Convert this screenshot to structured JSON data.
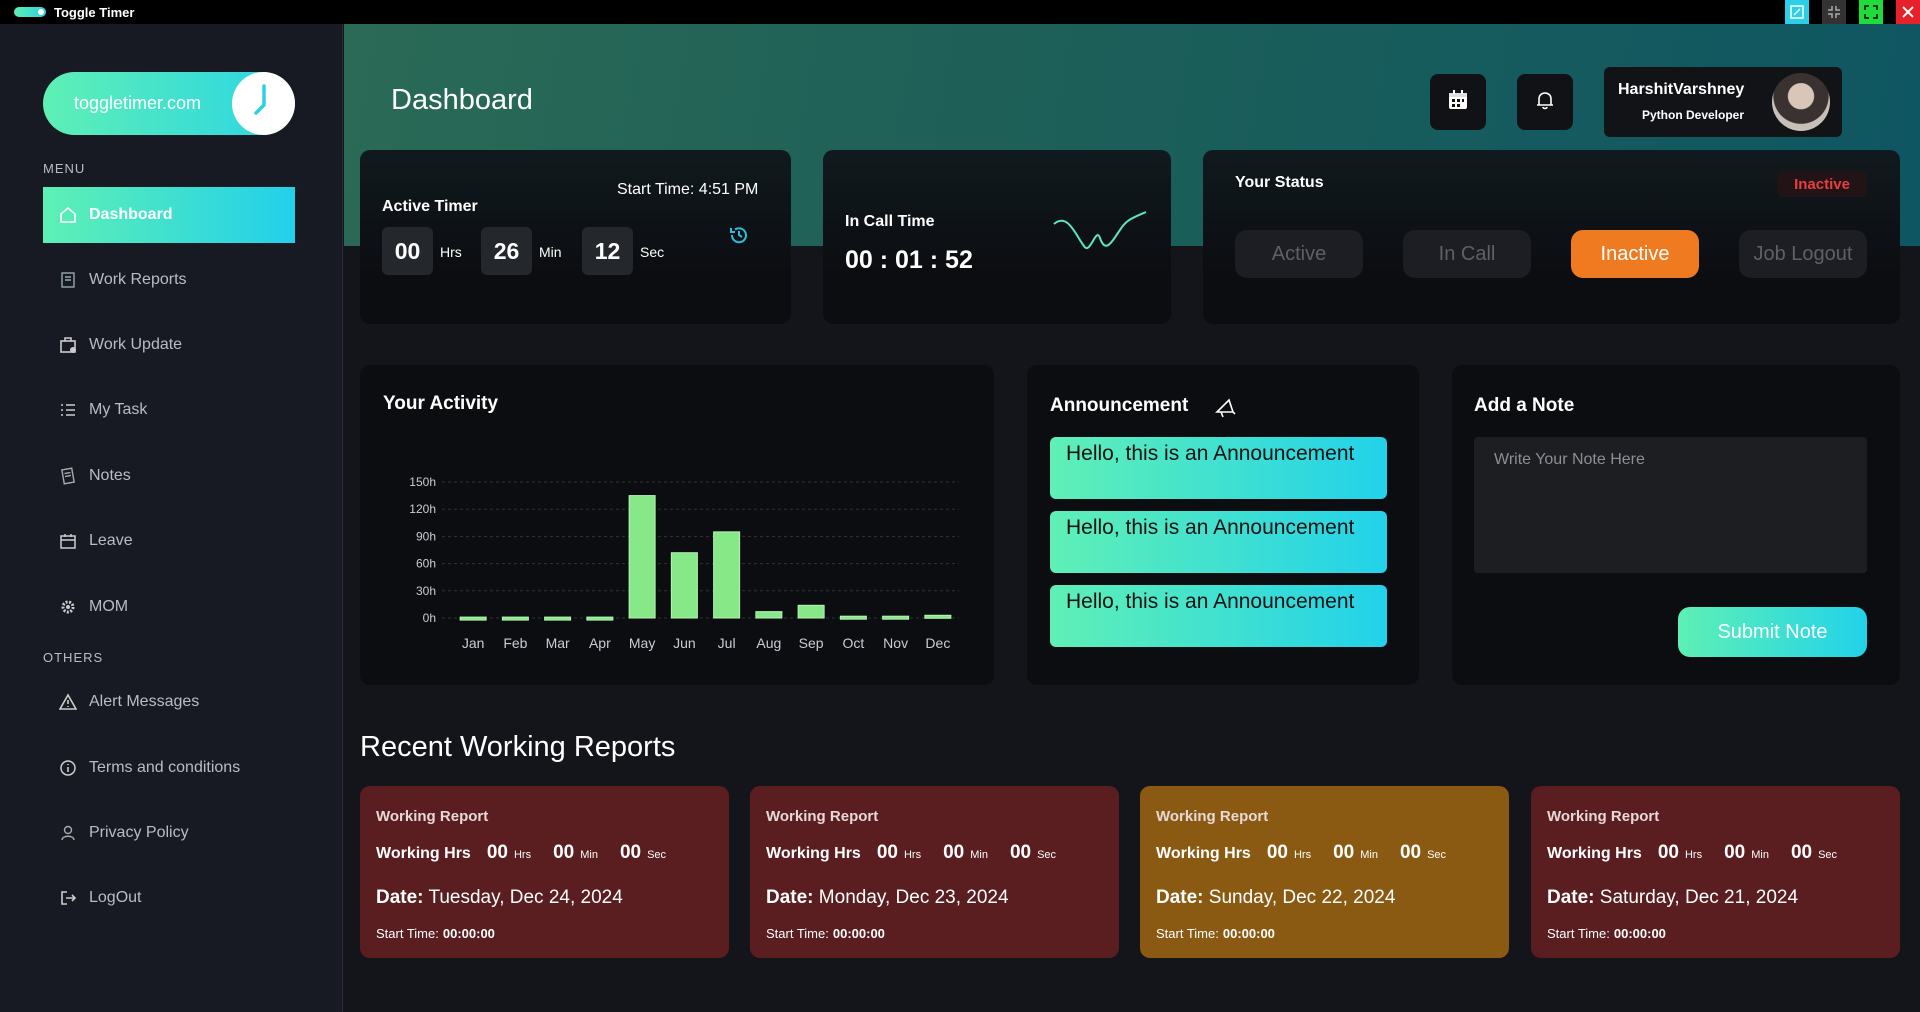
{
  "window": {
    "title": "Toggle Timer"
  },
  "sidebar": {
    "brand": "toggletimer.com",
    "menu_label": "MENU",
    "others_label": "OTHERS",
    "items": [
      {
        "label": "Dashboard",
        "icon": "home-icon"
      },
      {
        "label": "Work Reports",
        "icon": "report-icon"
      },
      {
        "label": "Work Update",
        "icon": "briefcase-icon"
      },
      {
        "label": "My Task",
        "icon": "tasklist-icon"
      },
      {
        "label": "Notes",
        "icon": "note-icon"
      },
      {
        "label": "Leave",
        "icon": "calendar-icon"
      },
      {
        "label": "MOM",
        "icon": "gear-icon"
      }
    ],
    "others": [
      {
        "label": "Alert Messages",
        "icon": "warning-icon"
      },
      {
        "label": "Terms and conditions",
        "icon": "info-icon"
      },
      {
        "label": "Privacy Policy",
        "icon": "user-icon"
      },
      {
        "label": "LogOut",
        "icon": "logout-icon"
      }
    ]
  },
  "header": {
    "title": "Dashboard",
    "user": {
      "name": "HarshitVarshney",
      "role": "Python Developer"
    }
  },
  "active_timer": {
    "title": "Active Timer",
    "start_time": "Start Time: 4:51 PM",
    "hrs": "00",
    "hrs_unit": "Hrs",
    "min": "26",
    "min_unit": "Min",
    "sec": "12",
    "sec_unit": "Sec"
  },
  "in_call": {
    "title": "In Call Time",
    "time": "00 : 01 : 52"
  },
  "status": {
    "title": "Your Status",
    "badge": "Inactive",
    "options": [
      "Active",
      "In Call",
      "Inactive",
      "Job Logout"
    ],
    "selected": "Inactive",
    "accent": "#f07a20"
  },
  "activity": {
    "title": "Your Activity"
  },
  "chart_data": {
    "type": "bar",
    "categories": [
      "Jan",
      "Feb",
      "Mar",
      "Apr",
      "May",
      "Jun",
      "Jul",
      "Aug",
      "Sep",
      "Oct",
      "Nov",
      "Dec"
    ],
    "values": [
      1,
      1,
      1,
      1,
      135,
      72,
      95,
      7,
      14,
      2,
      2,
      3
    ],
    "yticks": [
      "0h",
      "30h",
      "60h",
      "90h",
      "120h",
      "150h"
    ],
    "ylim": [
      0,
      150
    ],
    "grid": true,
    "color": "#86e887"
  },
  "announcement": {
    "title": "Announcement",
    "items": [
      "Hello, this is an Announcement",
      "Hello, this is an Announcement",
      "Hello, this is an Announcement"
    ]
  },
  "note": {
    "title": "Add a Note",
    "placeholder": "Write Your Note Here",
    "submit": "Submit Note"
  },
  "recent": {
    "title": "Recent Working Reports",
    "reports": [
      {
        "title": "Working Report",
        "hrs_label": "Working Hrs",
        "hrs": "00",
        "min": "00",
        "sec": "00",
        "date_label": "Date:",
        "date": "Tuesday, Dec 24, 2024",
        "start_label": "Start Time:",
        "start": "00:00:00",
        "color": "#5a1d20"
      },
      {
        "title": "Working Report",
        "hrs_label": "Working Hrs",
        "hrs": "00",
        "min": "00",
        "sec": "00",
        "date_label": "Date:",
        "date": "Monday, Dec 23, 2024",
        "start_label": "Start Time:",
        "start": "00:00:00",
        "color": "#5a1d20"
      },
      {
        "title": "Working Report",
        "hrs_label": "Working Hrs",
        "hrs": "00",
        "min": "00",
        "sec": "00",
        "date_label": "Date:",
        "date": "Sunday, Dec 22, 2024",
        "start_label": "Start Time:",
        "start": "00:00:00",
        "color": "#8b5a12"
      },
      {
        "title": "Working Report",
        "hrs_label": "Working Hrs",
        "hrs": "00",
        "min": "00",
        "sec": "00",
        "date_label": "Date:",
        "date": "Saturday, Dec 21, 2024",
        "start_label": "Start Time:",
        "start": "00:00:00",
        "color": "#5a1d20"
      }
    ],
    "units": {
      "hrs": "Hrs",
      "min": "Min",
      "sec": "Sec"
    }
  }
}
